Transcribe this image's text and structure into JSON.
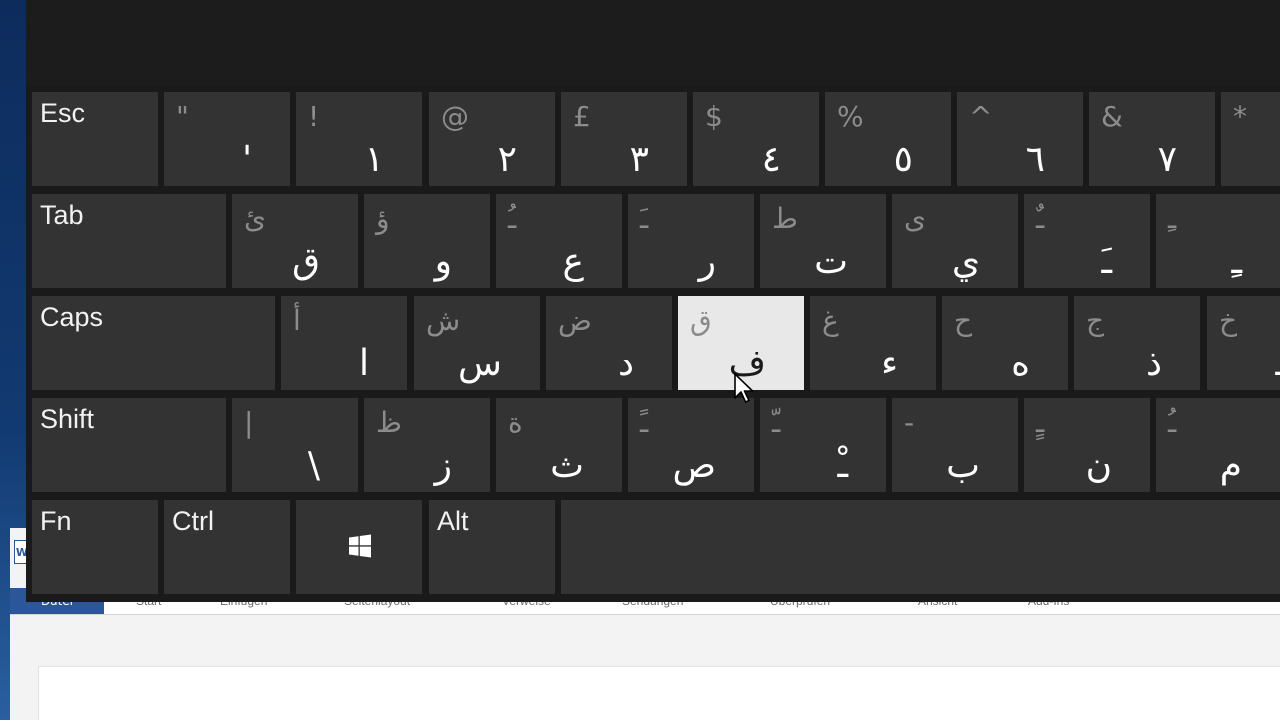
{
  "word": {
    "app_icon": "W",
    "ribbon": {
      "active_tab": "Datei",
      "tabs": [
        "Start",
        "Einfügen",
        "Seitenlayout",
        "Verweise",
        "Sendungen",
        "Überprüfen",
        "Ansicht",
        "Add-Ins"
      ]
    }
  },
  "keyboard": {
    "colors": {
      "key_bg": "#333333",
      "key_active_bg": "#e8e8e8",
      "window_bg": "#1a1a1a"
    },
    "highlighted_key": "ف",
    "rows": [
      [
        {
          "label": "Esc"
        },
        {
          "secondary": "\"",
          "primary": "'"
        },
        {
          "secondary": "!",
          "primary": "١"
        },
        {
          "secondary": "@",
          "primary": "٢"
        },
        {
          "secondary": "£",
          "primary": "٣"
        },
        {
          "secondary": "$",
          "primary": "٤"
        },
        {
          "secondary": "%",
          "primary": "٥"
        },
        {
          "secondary": "^",
          "primary": "٦"
        },
        {
          "secondary": "&",
          "primary": "٧"
        },
        {
          "secondary": "*",
          "primary": ""
        }
      ],
      [
        {
          "label": "Tab"
        },
        {
          "secondary": "ئ",
          "primary": "ق"
        },
        {
          "secondary": "ؤ",
          "primary": "و"
        },
        {
          "secondary": "ـُ",
          "primary": "ع"
        },
        {
          "secondary": "ـَ",
          "primary": "ر"
        },
        {
          "secondary": "ط",
          "primary": "ت"
        },
        {
          "secondary": "ى",
          "primary": "ي"
        },
        {
          "secondary": "ـٌ",
          "primary": "ـَ"
        },
        {
          "secondary": "ـِ",
          "primary": "ـِ"
        }
      ],
      [
        {
          "label": "Caps"
        },
        {
          "secondary": "أ",
          "primary": "ا"
        },
        {
          "secondary": "ش",
          "primary": "س"
        },
        {
          "secondary": "ض",
          "primary": "د"
        },
        {
          "secondary": "ق",
          "primary": "ف"
        },
        {
          "secondary": "غ",
          "primary": "ء"
        },
        {
          "secondary": "ح",
          "primary": "ه"
        },
        {
          "secondary": "ج",
          "primary": "ذ"
        },
        {
          "secondary": "خ",
          "primary": "ـ"
        }
      ],
      [
        {
          "label": "Shift"
        },
        {
          "secondary": "|",
          "primary": "\\"
        },
        {
          "secondary": "ظ",
          "primary": "ز"
        },
        {
          "secondary": "ة",
          "primary": "ث"
        },
        {
          "secondary": "ـً",
          "primary": "ص"
        },
        {
          "secondary": "ـّ",
          "primary": "ـْ"
        },
        {
          "secondary": "-",
          "primary": "ب"
        },
        {
          "secondary": "ـٍ",
          "primary": "ن"
        },
        {
          "secondary": "ـُ",
          "primary": "م"
        }
      ],
      [
        {
          "label": "Fn"
        },
        {
          "label": "Ctrl"
        },
        {
          "icon": "windows-logo-icon"
        },
        {
          "label": "Alt"
        },
        {
          "label": ""
        }
      ]
    ]
  }
}
